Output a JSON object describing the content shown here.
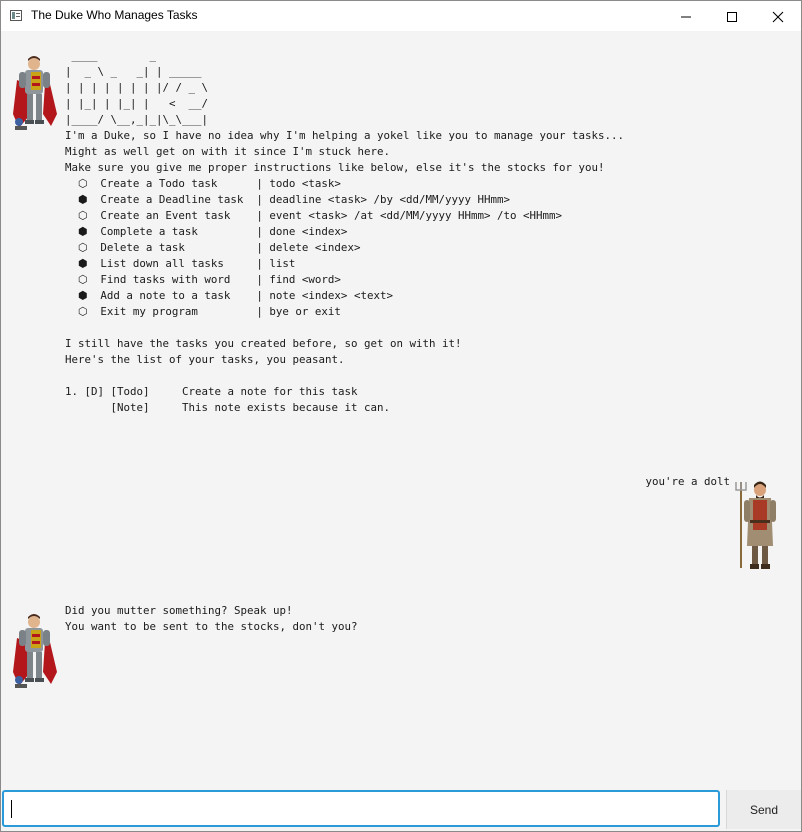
{
  "window": {
    "title": "The Duke Who Manages Tasks"
  },
  "chat": {
    "welcome_text": " ____        _\n|  _ \\ _   _| | _____\n| | | | | | | |/ / _ \\\n| |_| | |_| |   <  __/\n|____/ \\__,_|_|\\_\\___|\nI'm a Duke, so I have no idea why I'm helping a yokel like you to manage your tasks...\nMight as well get on with it since I'm stuck here.\nMake sure you give me proper instructions like below, else it's the stocks for you!\n  ⬡  Create a Todo task      | todo <task>\n  ⬢  Create a Deadline task  | deadline <task> /by <dd/MM/yyyy HHmm>\n  ⬡  Create an Event task    | event <task> /at <dd/MM/yyyy HHmm> /to <HHmm>\n  ⬢  Complete a task         | done <index>\n  ⬡  Delete a task           | delete <index>\n  ⬢  List down all tasks     | list\n  ⬡  Find tasks with word    | find <word>\n  ⬢  Add a note to a task    | note <index> <text>\n  ⬡  Exit my program         | bye or exit\n\nI still have the tasks you created before, so get on with it!\nHere's the list of your tasks, you peasant.\n\n1. [D] [Todo]     Create a note for this task\n       [Note]     This note exists because it can.",
    "user_text": "you're a dolt",
    "reply_text": "Did you mutter something? Speak up!\nYou want to be sent to the stocks, don't you?"
  },
  "input": {
    "value": "",
    "placeholder": ""
  },
  "send_button": {
    "label": "Send"
  },
  "colors": {
    "accent": "#2a9bd8",
    "background": "#f4f4f4"
  },
  "icons": [
    "window-app-icon",
    "minimize-icon",
    "maximize-icon",
    "close-icon",
    "duke-avatar-icon",
    "peasant-avatar-icon"
  ]
}
